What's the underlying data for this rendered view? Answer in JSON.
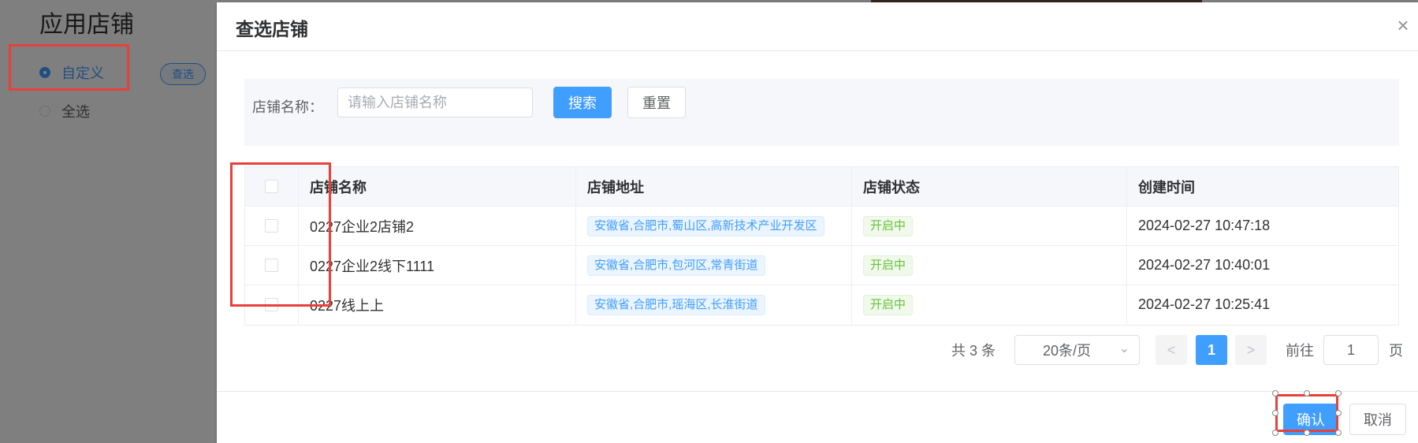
{
  "background": {
    "title": "应用店铺",
    "radios": [
      {
        "label": "自定义",
        "checked": true
      },
      {
        "label": "全选",
        "checked": false
      }
    ],
    "query_chip": "查选"
  },
  "dialog": {
    "title": "查选店铺",
    "search": {
      "label": "店铺名称：",
      "placeholder": "请输入店铺名称",
      "value": "",
      "search_button": "搜索",
      "reset_button": "重置"
    },
    "table": {
      "columns": [
        "",
        "店铺名称",
        "店铺地址",
        "店铺状态",
        "创建时间"
      ],
      "rows": [
        {
          "name": "0227企业2店铺2",
          "address": "安徽省,合肥市,蜀山区,高新技术产业开发区",
          "status": "开启中",
          "created": "2024-02-27 10:47:18"
        },
        {
          "name": "0227企业2线下1111",
          "address": "安徽省,合肥市,包河区,常青街道",
          "status": "开启中",
          "created": "2024-02-27 10:40:01"
        },
        {
          "name": "0227线上上",
          "address": "安徽省,合肥市,瑶海区,长淮街道",
          "status": "开启中",
          "created": "2024-02-27 10:25:41"
        }
      ]
    },
    "pagination": {
      "total": "共 3 条",
      "page_size": "20条/页",
      "prev": "<",
      "current_page": "1",
      "next": ">",
      "goto_label": "前往",
      "goto_value": "1",
      "page_suffix": "页"
    },
    "footer": {
      "confirm": "确认",
      "cancel": "取消"
    },
    "close_glyph": "×"
  },
  "colors": {
    "primary": "#409eff",
    "success": "#67c23a",
    "annotation": "#e8403a"
  }
}
